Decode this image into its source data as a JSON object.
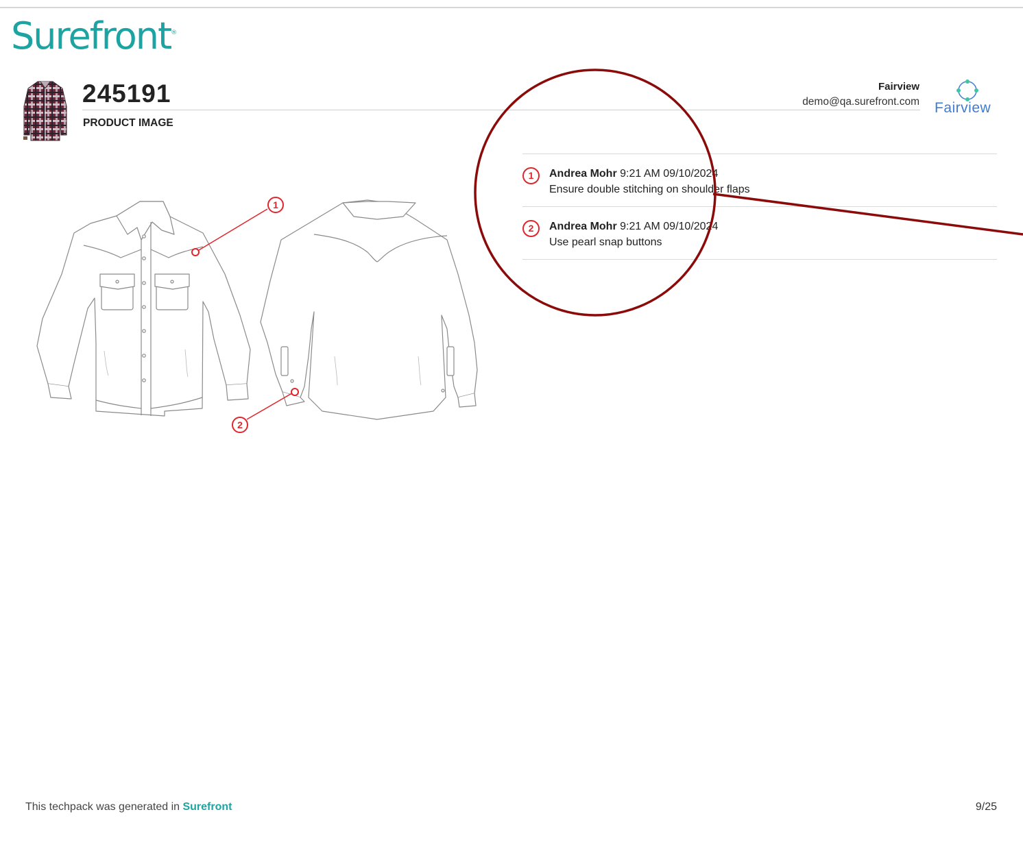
{
  "header": {
    "brand": "Surefront",
    "brand_mark": "®",
    "product_number": "245191",
    "section_label": "PRODUCT IMAGE",
    "account_name": "Fairview",
    "account_email": "demo@qa.surefront.com",
    "partner_logo_text": "Fairview"
  },
  "sketch": {
    "markers": [
      {
        "label": "1"
      },
      {
        "label": "2"
      }
    ],
    "line_color": "#e0262d"
  },
  "comments": [
    {
      "number": "1",
      "author": "Andrea Mohr",
      "timestamp": "9:21 AM 09/10/2024",
      "text": "Ensure double stitching on shoulder flaps"
    },
    {
      "number": "2",
      "author": "Andrea Mohr",
      "timestamp": "9:21 AM 09/10/2024",
      "text": "Use pearl snap buttons"
    }
  ],
  "footer": {
    "note_prefix": "This techpack was generated in",
    "note_brand": "Surefront",
    "page": "9/25"
  },
  "colors": {
    "brand": "#1ea3a3",
    "marker": "#e0262d",
    "highlight": "#8b0a0a",
    "partner": "#3e7cd1"
  }
}
